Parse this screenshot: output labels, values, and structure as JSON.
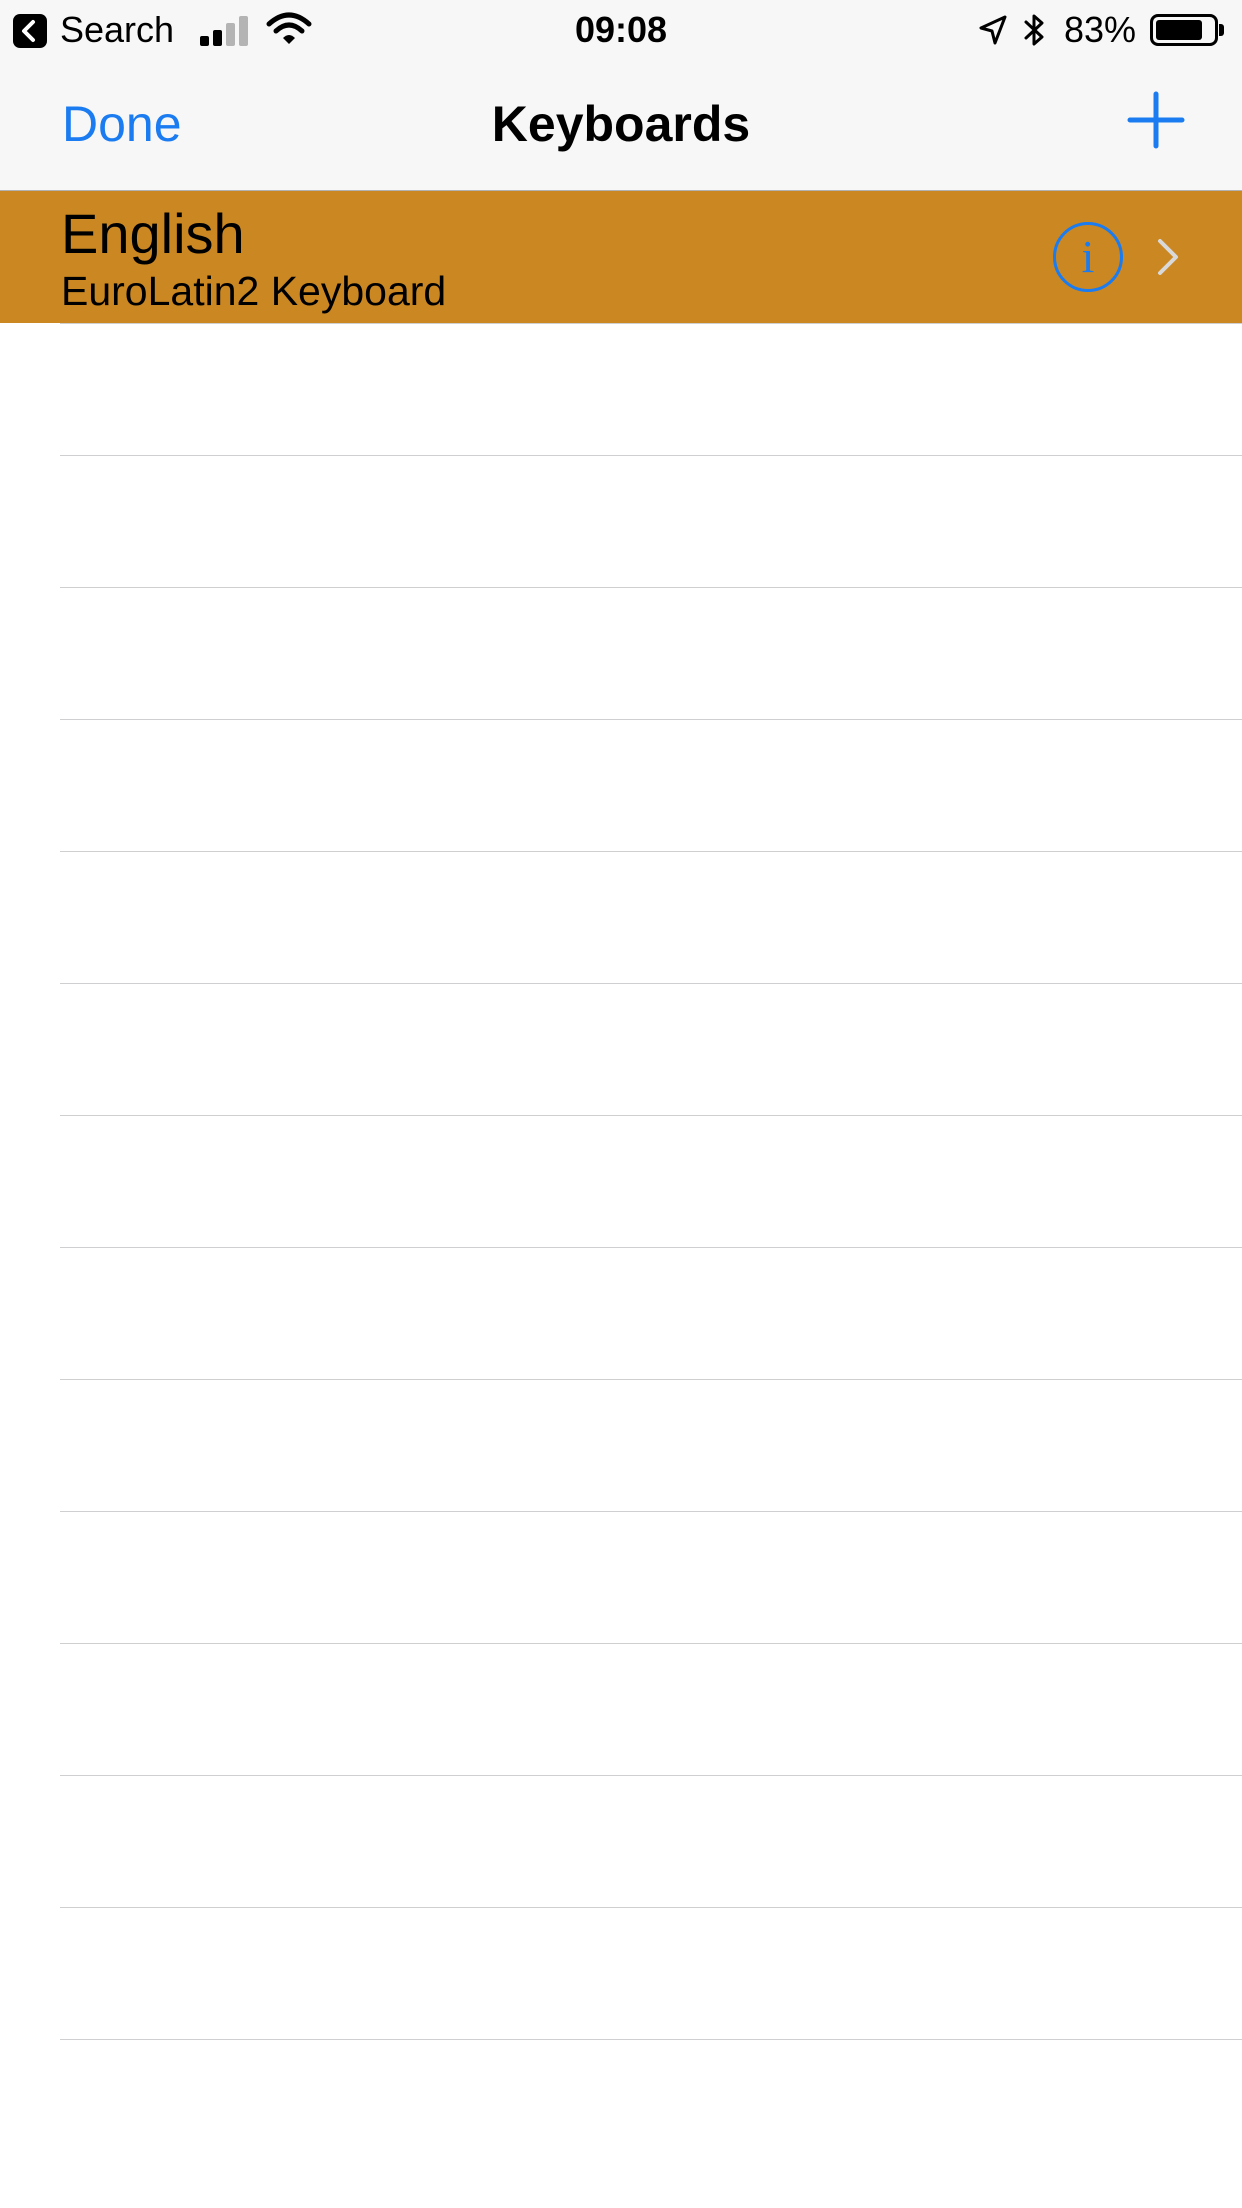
{
  "status_bar": {
    "back_label": "Search",
    "time": "09:08",
    "battery_percent": "83%",
    "battery_level": 0.83,
    "signal_bars_active": 2,
    "icons": [
      "back-icon",
      "cellular-signal-icon",
      "wifi-icon",
      "location-arrow-icon",
      "bluetooth-icon",
      "battery-icon"
    ]
  },
  "nav": {
    "done_label": "Done",
    "title": "Keyboards",
    "add_icon": "plus-icon"
  },
  "keyboards": [
    {
      "language": "English",
      "keyboard": "EuroLatin2 Keyboard",
      "info_icon": "info-icon",
      "chevron_icon": "chevron-right-icon",
      "selected": true
    }
  ],
  "colors": {
    "accent": "#1a7cf0",
    "selected_row": "#ca8722",
    "bar_background": "#f7f7f7",
    "separator": "#cfcfd2"
  }
}
